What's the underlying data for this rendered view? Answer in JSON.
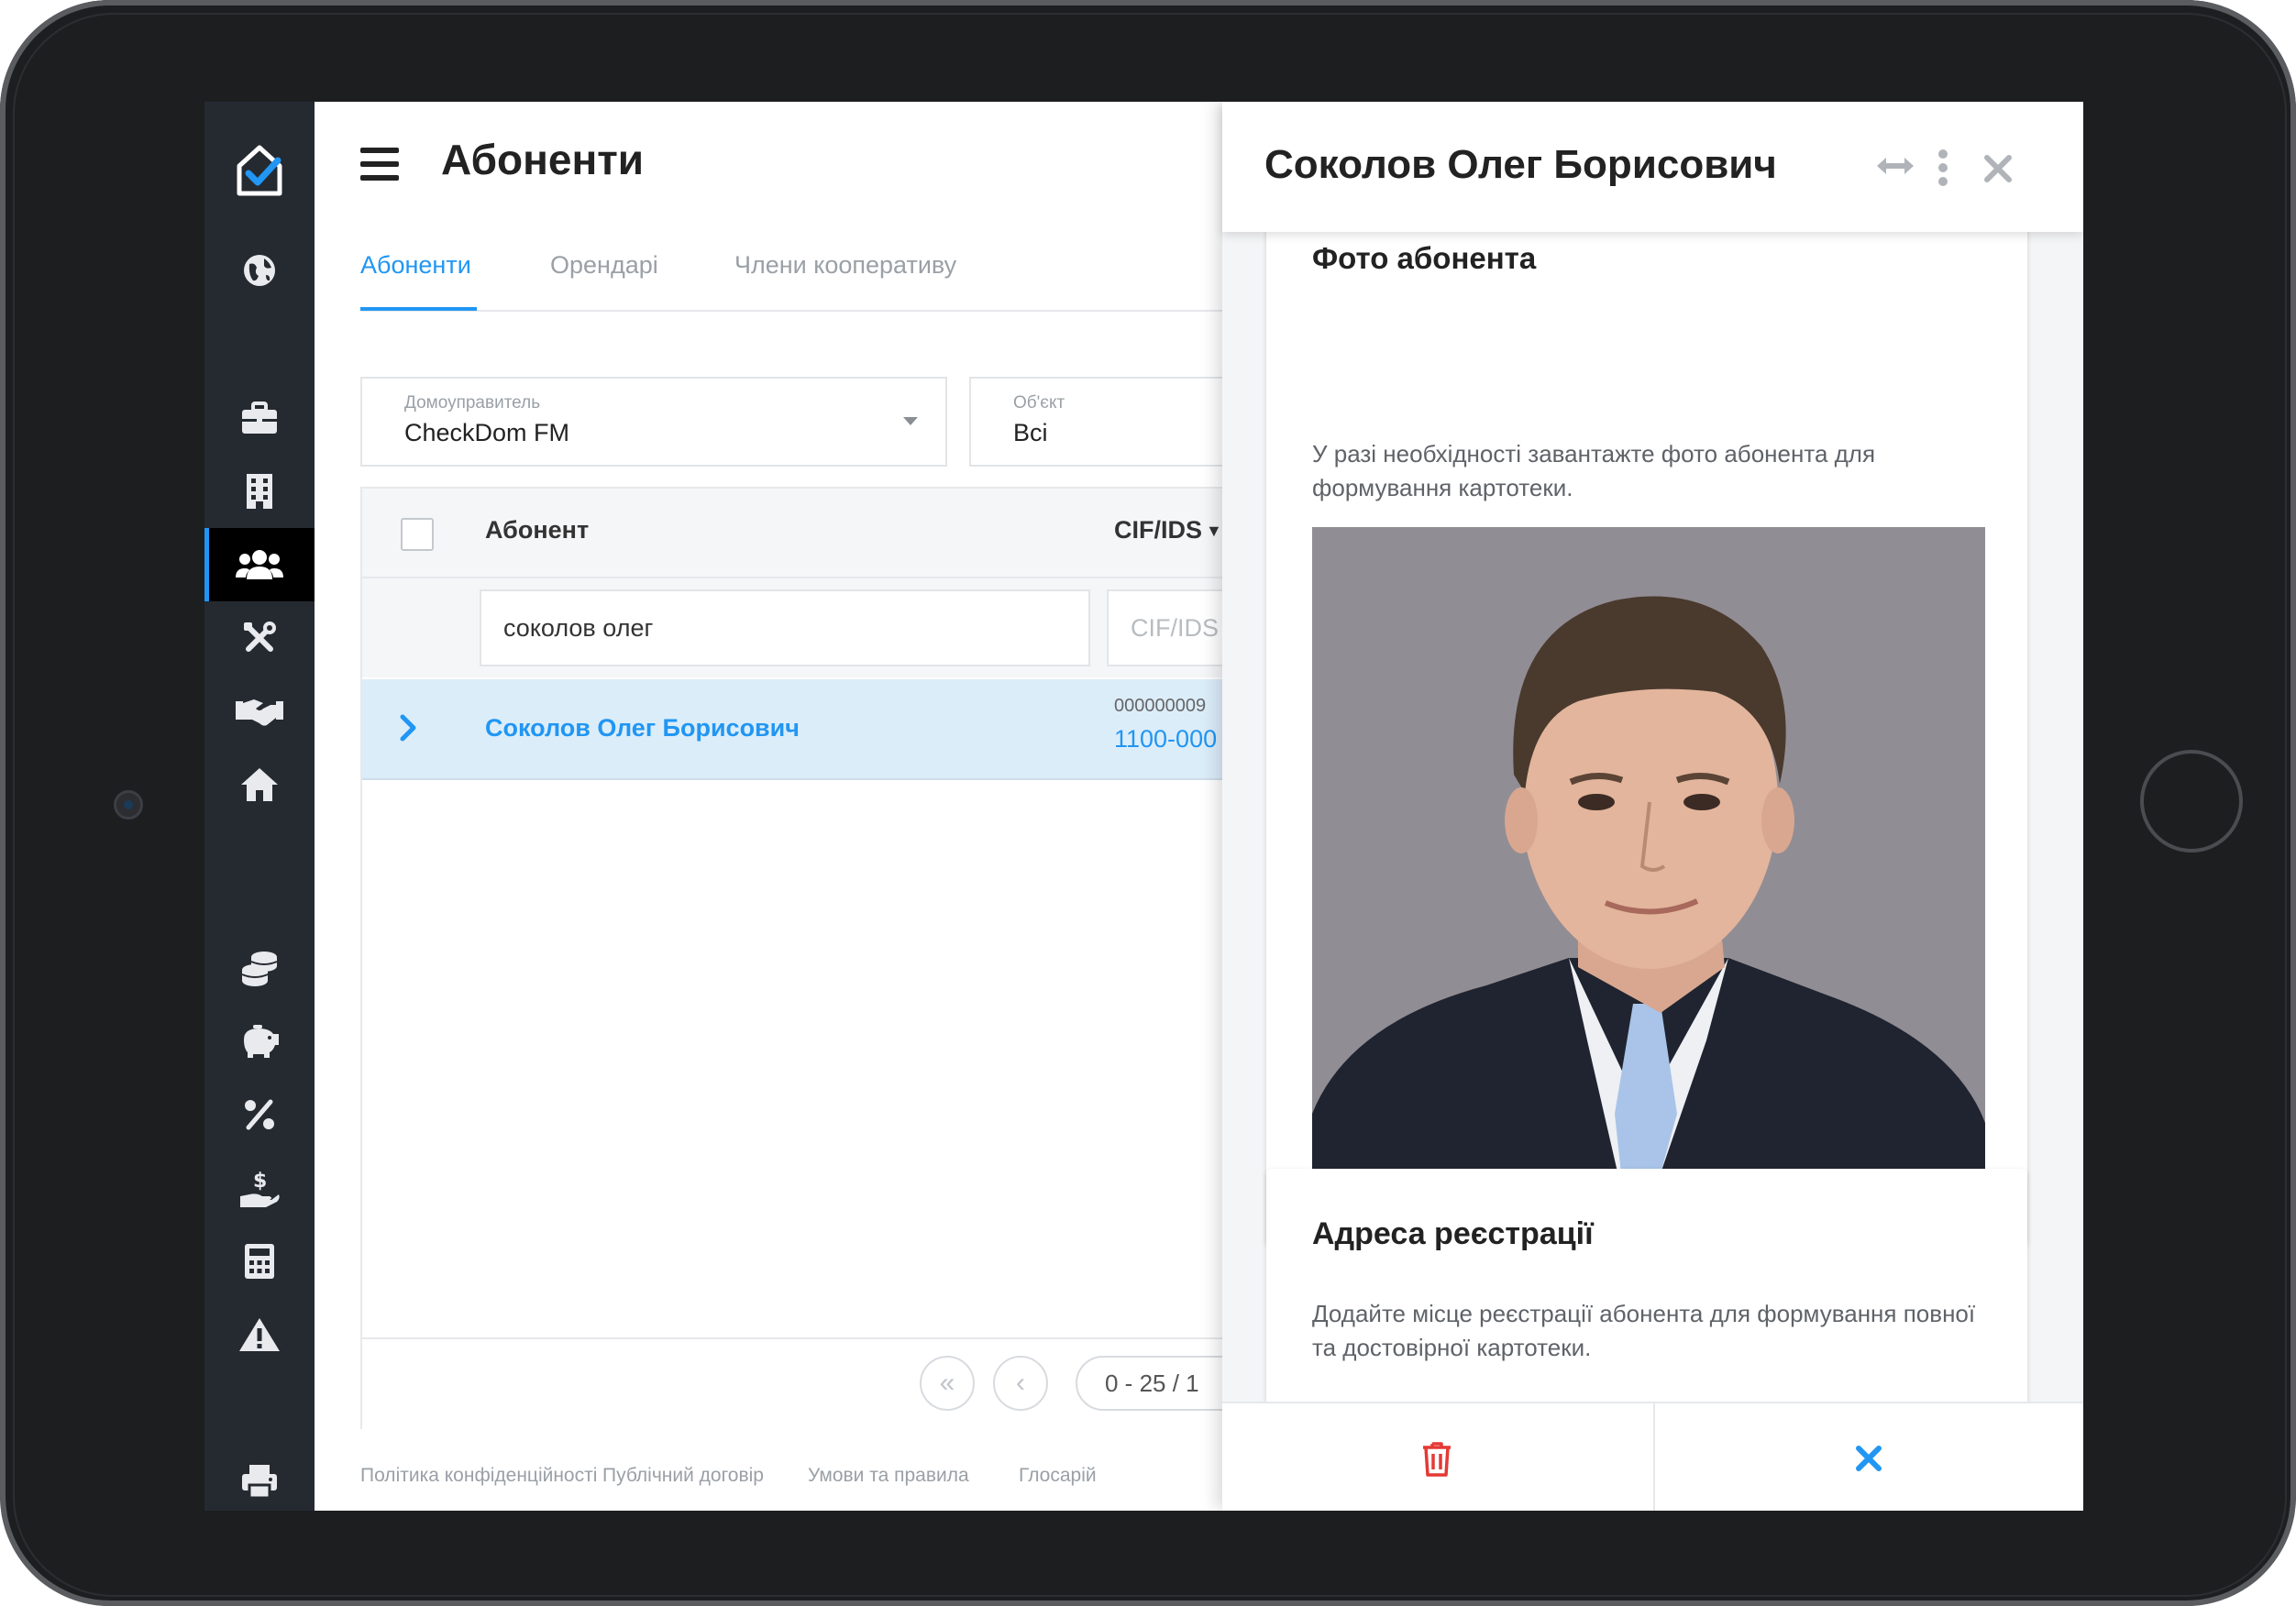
{
  "sidebar": {
    "items": [
      {
        "icon": "app-logo-icon"
      },
      {
        "icon": "globe-icon"
      },
      {
        "icon": "briefcase-icon"
      },
      {
        "icon": "building-icon"
      },
      {
        "icon": "users-icon"
      },
      {
        "icon": "tools-icon"
      },
      {
        "icon": "handshake-icon"
      },
      {
        "icon": "home-icon"
      },
      {
        "icon": "coins-icon"
      },
      {
        "icon": "piggy-bank-icon"
      },
      {
        "icon": "percent-icon"
      },
      {
        "icon": "hand-dollar-icon"
      },
      {
        "icon": "calculator-icon"
      },
      {
        "icon": "warning-icon"
      },
      {
        "icon": "printer-icon"
      }
    ],
    "active_index": 4
  },
  "header": {
    "title": "Абоненти"
  },
  "tabs": [
    {
      "label": "Абоненти",
      "active": true
    },
    {
      "label": "Орендарі",
      "active": false
    },
    {
      "label": "Члени кооперативу",
      "active": false
    }
  ],
  "filters": {
    "manager": {
      "label": "Домоуправитель",
      "value": "CheckDom FM"
    },
    "object": {
      "label": "Об'єкт",
      "value": "Всі"
    }
  },
  "table": {
    "columns": {
      "subscriber": "Абонент",
      "cif": "CIF/IDS"
    },
    "search": {
      "subscriber_value": "соколов олег",
      "cif_placeholder": "CIF/IDS"
    },
    "rows": [
      {
        "name": "Соколов Олег Борисович",
        "cif_small": "000000009",
        "cif": "1100-000"
      }
    ],
    "pagination": {
      "range": "0 - 25 / 1"
    }
  },
  "footer": {
    "links": [
      "Політика конфіденційності",
      "Публічний договір",
      "Умови та правила",
      "Глосарій"
    ]
  },
  "drawer": {
    "title": "Соколов Олег Борисович",
    "photo_card": {
      "title": "Фото абонента",
      "text": "У разі необхідності завантажте фото абонента для формування картотеки."
    },
    "address_card": {
      "title": "Адреса реєстрації",
      "text": "Додайте місце реєстрації абонента для формування повної та достовірної картотеки."
    }
  },
  "colors": {
    "accent": "#2196f3",
    "sidebar_bg": "#252a31",
    "danger": "#e53935"
  }
}
